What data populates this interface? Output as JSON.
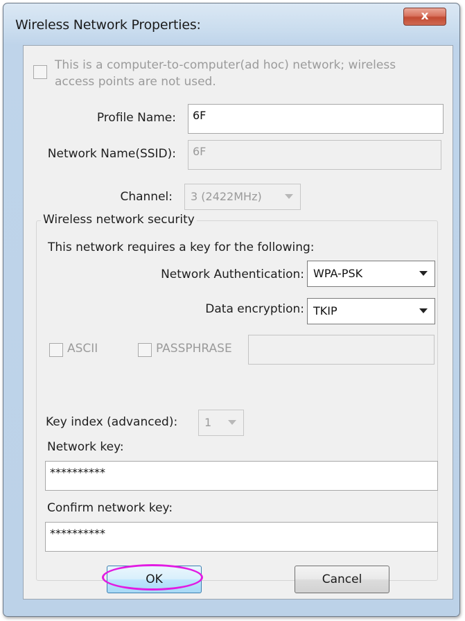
{
  "window": {
    "title": "Wireless Network Properties:",
    "close_glyph": "x"
  },
  "adhoc": {
    "line1": "This is a computer-to-computer(ad hoc) network; wireless",
    "line2": "access points are not used."
  },
  "profile": {
    "label": "Profile Name:",
    "value": "6F"
  },
  "ssid": {
    "label": "Network Name(SSID):",
    "value": "6F"
  },
  "channel": {
    "label": "Channel:",
    "value": "3 (2422MHz)"
  },
  "security": {
    "group_title": "Wireless network security",
    "requires_text": "This network requires a key for the following:",
    "auth_label": "Network Authentication:",
    "auth_value": "WPA-PSK",
    "encryption_label": "Data encryption:",
    "encryption_value": "TKIP",
    "ascii_label": "ASCII",
    "passphrase_label": "PASSPHRASE",
    "passphrase_value": "",
    "key_index_label": "Key index (advanced):",
    "key_index_value": "1",
    "network_key_label": "Network key:",
    "network_key_value": "**********",
    "confirm_key_label": "Confirm network key:",
    "confirm_key_value": "**********"
  },
  "buttons": {
    "ok": "OK",
    "cancel": "Cancel"
  },
  "colors": {
    "highlight_ring": "#e21be2",
    "close_button": "#c24a33"
  }
}
